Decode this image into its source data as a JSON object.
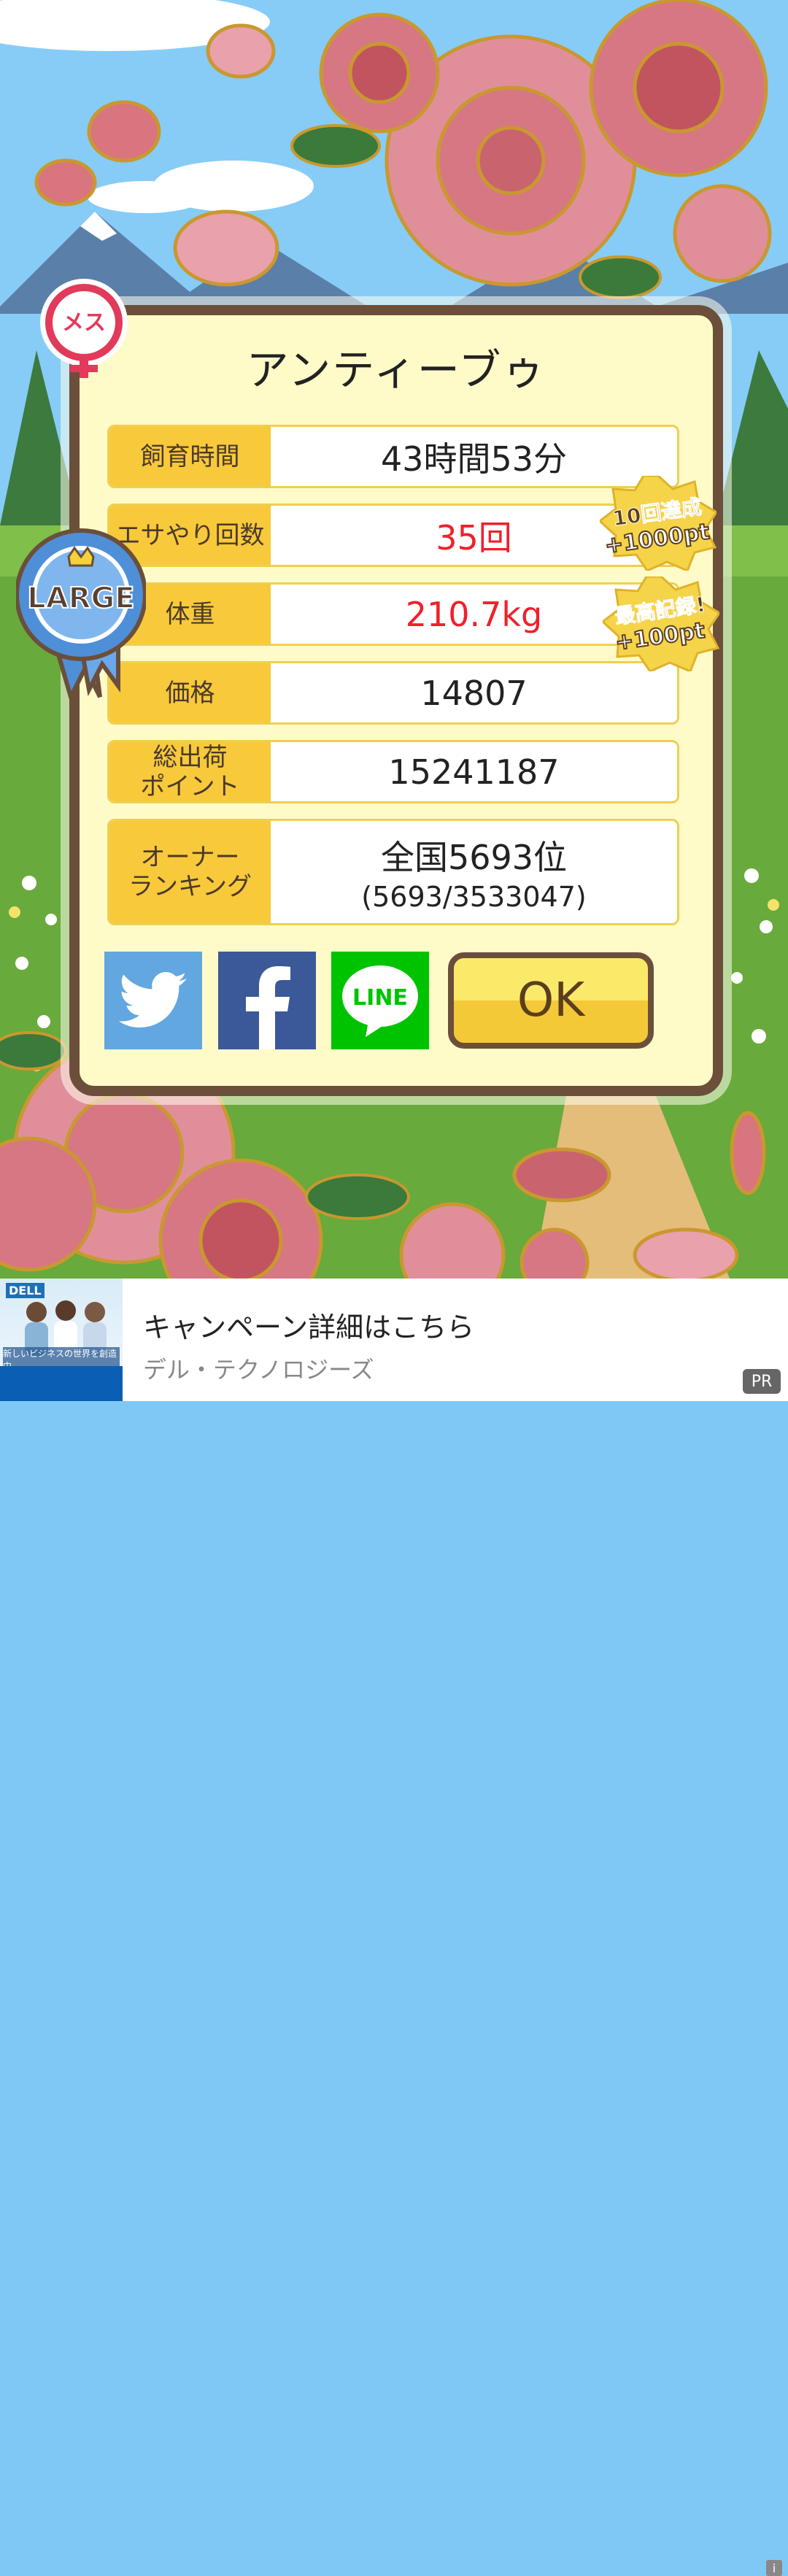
{
  "pet": {
    "name": "アンティーブゥ",
    "gender_badge": "メス",
    "size_badge": "LARGE"
  },
  "stats": [
    {
      "label": "飼育時間",
      "value": "43時間53分",
      "highlight": false
    },
    {
      "label": "エサやり回数",
      "value": "35回",
      "highlight": true
    },
    {
      "label": "体重",
      "value": "210.7kg",
      "highlight": true
    },
    {
      "label": "価格",
      "value": "14807",
      "highlight": false
    },
    {
      "label": "総出荷\nポイント",
      "value": "15241187",
      "highlight": false
    },
    {
      "label": "オーナー\nランキング",
      "value": "全国5693位",
      "subvalue": "(5693/3533047)",
      "highlight": false
    }
  ],
  "bonuses": [
    {
      "line1": "10回達成",
      "line2": "+1000pt"
    },
    {
      "line1": "最高記録!",
      "line2": "+100pt"
    }
  ],
  "share": {
    "twitter_icon": "twitter-bird-icon",
    "facebook_icon": "facebook-f-icon",
    "line_label": "LINE"
  },
  "ok_label": "OK",
  "ad": {
    "title": "キャンペーン詳細はこちら",
    "advertiser": "デル・テクノロジーズ",
    "pr_label": "PR",
    "info_label": "i",
    "thumb_brand": "DELL",
    "thumb_caption": "新しいビジネスの世界を創造中"
  },
  "colors": {
    "label_bg": "#f8c93a",
    "frame": "#6b4f3a",
    "highlight_text": "#f0202a",
    "twitter": "#62a7e0",
    "facebook": "#3b5998",
    "line": "#00c300",
    "ribbon": "#4f8fd8",
    "female_badge": "#e23a5a"
  }
}
